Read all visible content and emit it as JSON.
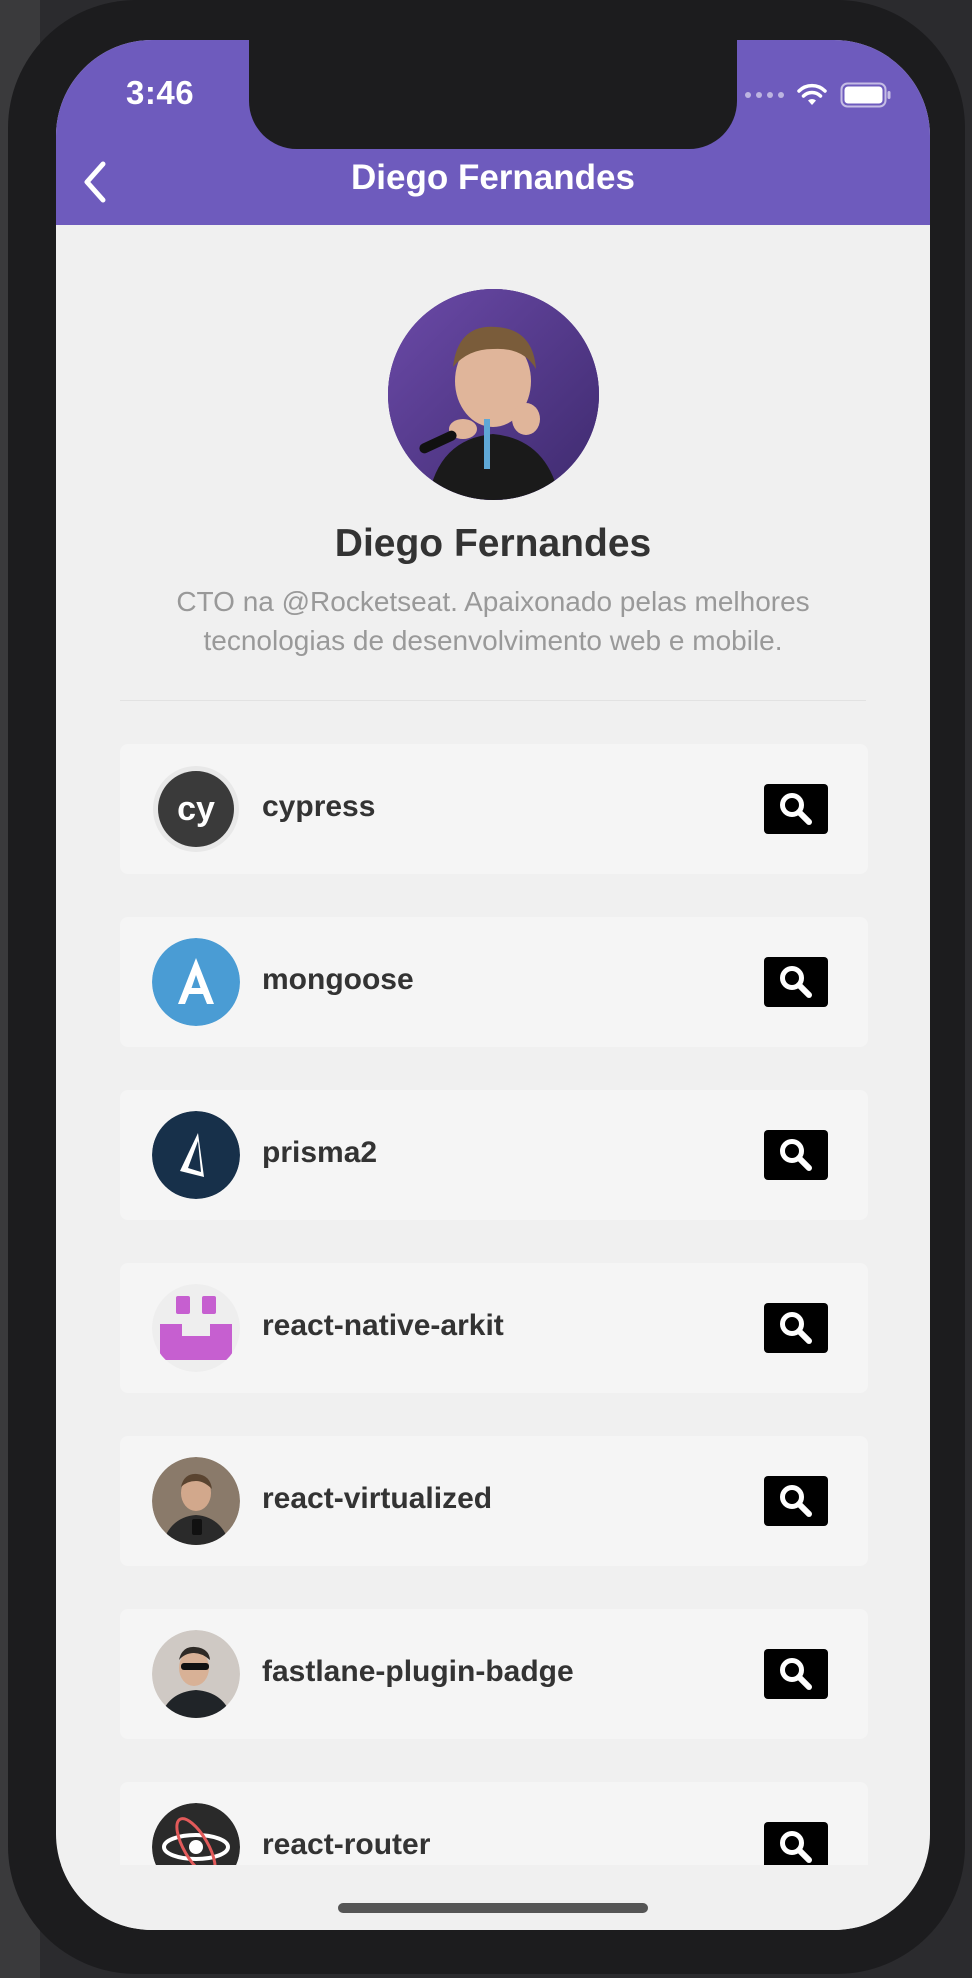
{
  "status_bar": {
    "time": "3:46"
  },
  "nav": {
    "title": "Diego Fernandes",
    "back_icon": "chevron-left-icon"
  },
  "profile": {
    "name": "Diego Fernandes",
    "bio": "CTO na @Rocketseat. Apaixonado pelas melhores tecnologias de desenvolvimento web e mobile."
  },
  "colors": {
    "header": "#6e5bbd",
    "background": "#f0f0f0",
    "card": "#f5f5f5",
    "button": "#000000"
  },
  "repos": [
    {
      "name": "cypress",
      "avatar": "cypress-logo"
    },
    {
      "name": "mongoose",
      "avatar": "mongoose-logo"
    },
    {
      "name": "prisma2",
      "avatar": "prisma-logo"
    },
    {
      "name": "react-native-arkit",
      "avatar": "arkit-logo"
    },
    {
      "name": "react-virtualized",
      "avatar": "user-photo"
    },
    {
      "name": "fastlane-plugin-badge",
      "avatar": "user-photo"
    },
    {
      "name": "react-router",
      "avatar": "react-training-logo"
    }
  ]
}
